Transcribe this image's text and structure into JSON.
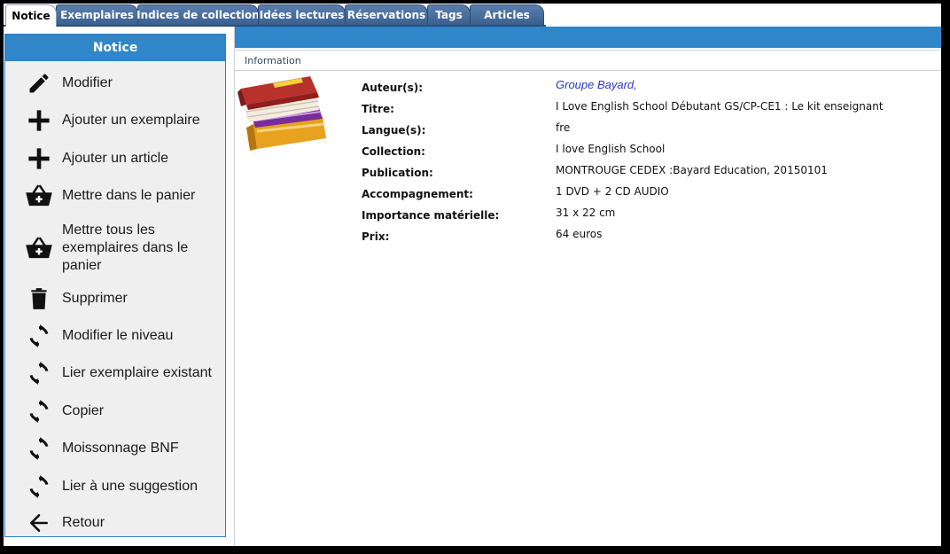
{
  "tabs": [
    {
      "label": "Notice",
      "active": true
    },
    {
      "label": "Exemplaires",
      "active": false
    },
    {
      "label": "Indices de collection",
      "active": false
    },
    {
      "label": "Idées lectures",
      "active": false
    },
    {
      "label": "Réservations",
      "active": false
    },
    {
      "label": "Tags",
      "active": false
    },
    {
      "label": "Articles",
      "active": false
    }
  ],
  "sidebar": {
    "title": "Notice",
    "items": [
      {
        "label": "Modifier",
        "icon": "pencil-icon"
      },
      {
        "label": "Ajouter un exemplaire",
        "icon": "plus-icon"
      },
      {
        "label": "Ajouter un article",
        "icon": "plus-icon"
      },
      {
        "label": "Mettre dans le panier",
        "icon": "basket-icon"
      },
      {
        "label": "Mettre tous les exemplaires dans le panier",
        "icon": "basket-icon"
      },
      {
        "label": "Supprimer",
        "icon": "trash-icon"
      },
      {
        "label": "Modifier le niveau",
        "icon": "refresh-icon"
      },
      {
        "label": "Lier exemplaire existant",
        "icon": "refresh-icon"
      },
      {
        "label": "Copier",
        "icon": "refresh-icon"
      },
      {
        "label": "Moissonnage BNF",
        "icon": "refresh-icon"
      },
      {
        "label": "Lier à une suggestion",
        "icon": "refresh-icon"
      },
      {
        "label": "Retour",
        "icon": "arrow-left-icon"
      }
    ]
  },
  "main": {
    "section_title": "Information",
    "cover_icon": "books-icon",
    "fields": [
      {
        "label": "Auteur(s):",
        "value": "Groupe Bayard,",
        "link": true
      },
      {
        "label": "Titre:",
        "value": "I Love English School Débutant GS/CP-CE1 : Le kit enseignant",
        "link": false
      },
      {
        "label": "Langue(s):",
        "value": "fre",
        "link": false
      },
      {
        "label": "Collection:",
        "value": "I love English School",
        "link": false
      },
      {
        "label": "Publication:",
        "value": "MONTROUGE CEDEX :Bayard Education, 20150101",
        "link": false
      },
      {
        "label": "Accompagnement:",
        "value": "1 DVD + 2 CD AUDIO",
        "link": false
      },
      {
        "label": "Importance matérielle:",
        "value": "31 x 22 cm",
        "link": false
      },
      {
        "label": "Prix:",
        "value": "64 euros",
        "link": false
      }
    ]
  },
  "colors": {
    "accent": "#2f86c8",
    "tab": "#3b5f8e",
    "link": "#2b36c8",
    "sidebar_bg": "#f0eff0"
  }
}
